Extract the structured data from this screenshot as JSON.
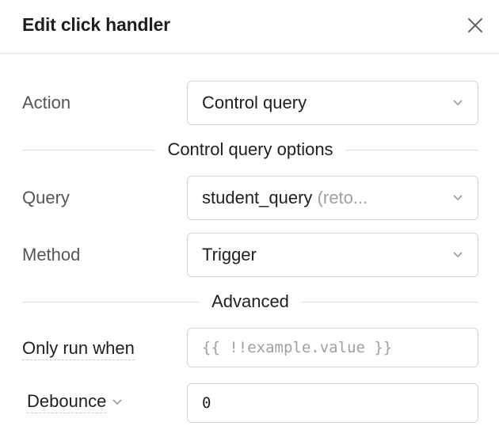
{
  "header": {
    "title": "Edit click handler",
    "close_icon": "close-icon"
  },
  "action": {
    "label": "Action",
    "value": "Control query"
  },
  "control_query_divider": "Control query options",
  "query": {
    "label": "Query",
    "value": "student_query",
    "hint": "(reto..."
  },
  "method": {
    "label": "Method",
    "value": "Trigger"
  },
  "advanced_divider": "Advanced",
  "only_run_when": {
    "label": "Only run when",
    "placeholder": "{{ !!example.value }}",
    "value": ""
  },
  "debounce": {
    "label": "Debounce",
    "value": "0"
  },
  "colors": {
    "border": "#d4d4d4",
    "text": "#1f1f1f",
    "muted": "#555555",
    "placeholder": "#a0a0a0"
  }
}
